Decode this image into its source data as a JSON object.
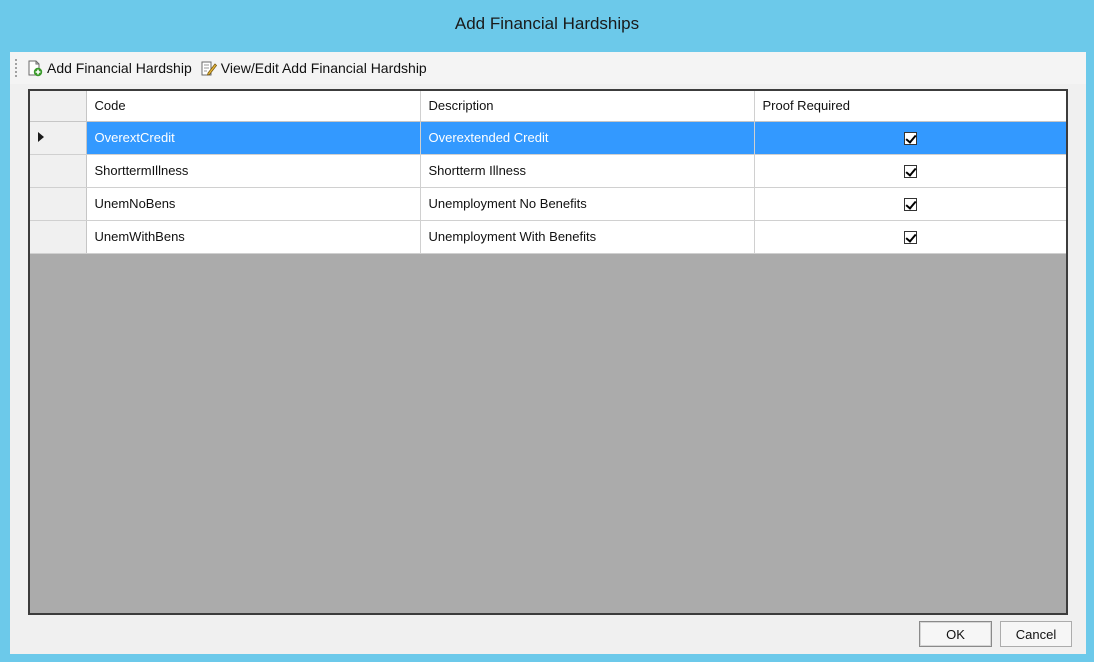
{
  "window": {
    "title": "Add Financial Hardships"
  },
  "toolbar": {
    "add_label": "Add Financial Hardship",
    "edit_label": "View/Edit Add Financial Hardship"
  },
  "grid": {
    "columns": [
      "Code",
      "Description",
      "Proof Required"
    ],
    "rows": [
      {
        "code": "OverextCredit",
        "description": "Overextended Credit",
        "proof_required": true,
        "selected": true
      },
      {
        "code": "ShorttermIllness",
        "description": "Shortterm Illness",
        "proof_required": true,
        "selected": false
      },
      {
        "code": "UnemNoBens",
        "description": "Unemployment No Benefits",
        "proof_required": true,
        "selected": false
      },
      {
        "code": "UnemWithBens",
        "description": "Unemployment With Benefits",
        "proof_required": true,
        "selected": false
      }
    ]
  },
  "buttons": {
    "ok": "OK",
    "cancel": "Cancel"
  },
  "colors": {
    "title_bar": "#6cc9ea",
    "selection": "#3399ff",
    "grid_empty": "#ababab"
  }
}
